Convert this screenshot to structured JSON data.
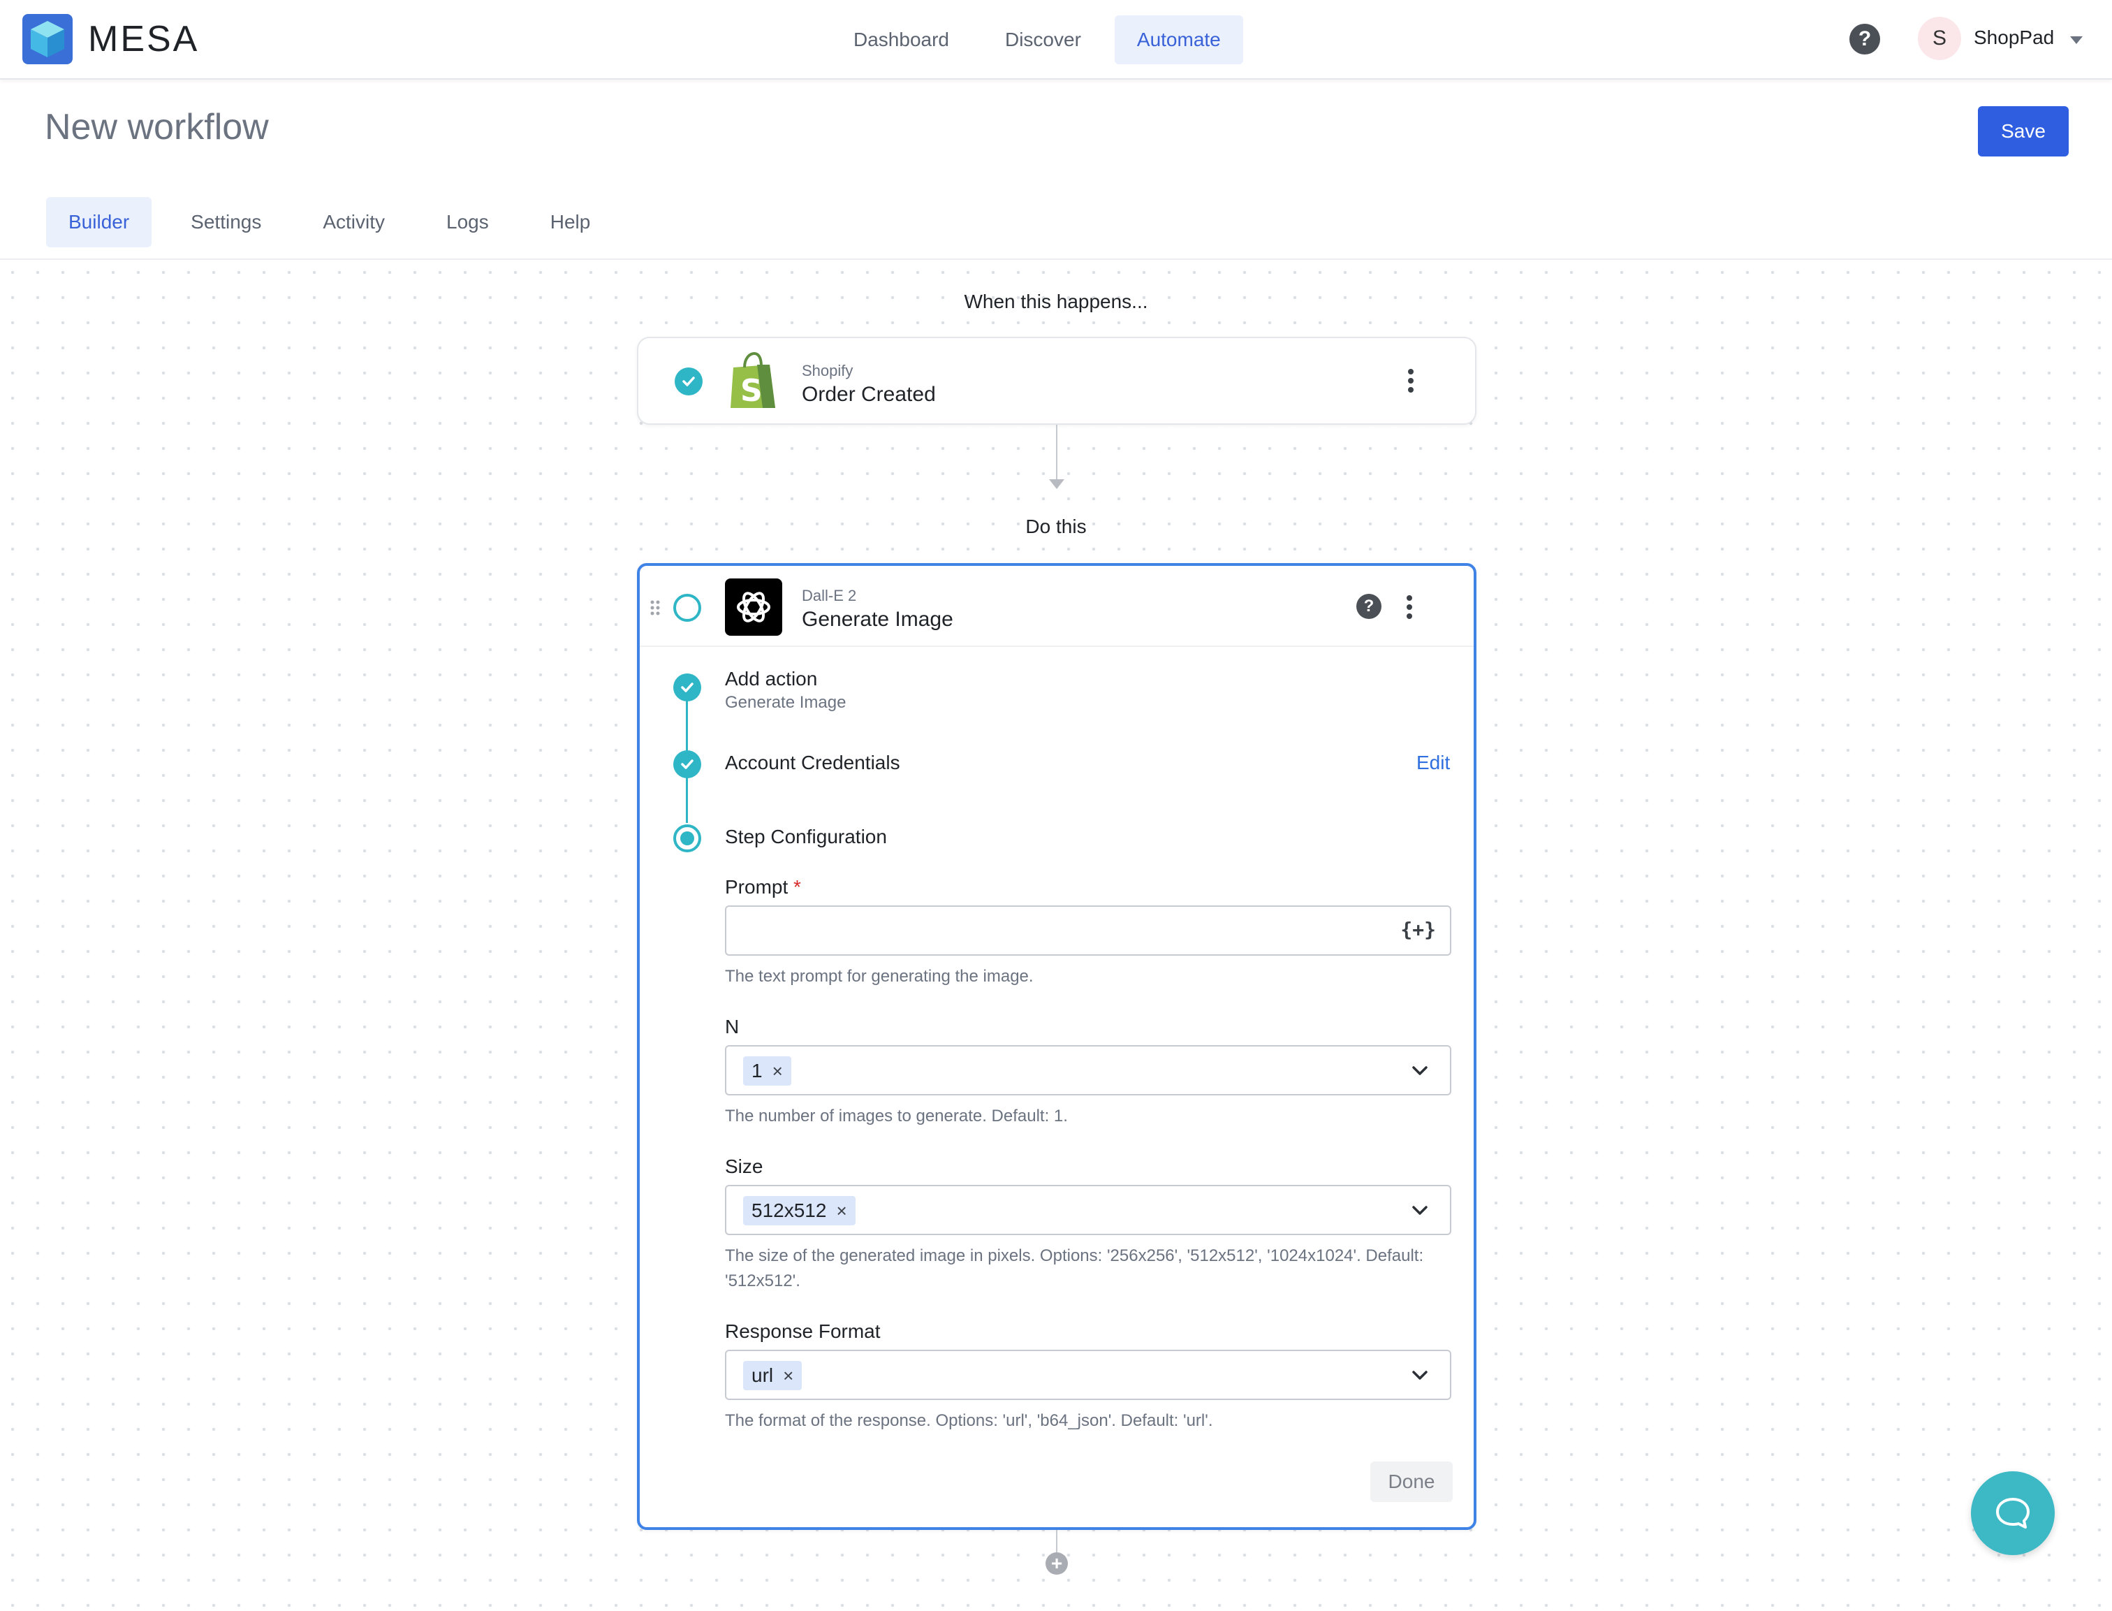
{
  "app": {
    "brand": "MESA"
  },
  "nav": {
    "items": [
      {
        "label": "Dashboard",
        "active": false
      },
      {
        "label": "Discover",
        "active": false
      },
      {
        "label": "Automate",
        "active": true
      }
    ]
  },
  "account": {
    "help_icon": "question-circle-icon",
    "avatar_letter": "S",
    "name": "ShopPad"
  },
  "header": {
    "title": "New workflow",
    "save_label": "Save"
  },
  "tabs": [
    {
      "label": "Builder",
      "active": true
    },
    {
      "label": "Settings",
      "active": false
    },
    {
      "label": "Activity",
      "active": false
    },
    {
      "label": "Logs",
      "active": false
    },
    {
      "label": "Help",
      "active": false
    }
  ],
  "trigger": {
    "section_label": "When this happens...",
    "app": "Shopify",
    "event": "Order Created",
    "status": "complete"
  },
  "action": {
    "section_label": "Do this",
    "app": "Dall-E 2",
    "event": "Generate Image",
    "steps": [
      {
        "title": "Add action",
        "subtitle": "Generate Image",
        "status": "complete"
      },
      {
        "title": "Account Credentials",
        "link": "Edit",
        "status": "complete"
      },
      {
        "title": "Step Configuration",
        "status": "active"
      }
    ],
    "fields": {
      "prompt": {
        "label": "Prompt",
        "required_mark": "*",
        "value": "",
        "variable_button": "{+}",
        "help": "The text prompt for generating the image."
      },
      "n": {
        "label": "N",
        "chip": "1",
        "help": "The number of images to generate. Default: 1."
      },
      "size": {
        "label": "Size",
        "chip": "512x512",
        "help": "The size of the generated image in pixels. Options: '256x256', '512x512', '1024x1024'. Default: '512x512'."
      },
      "response_format": {
        "label": "Response Format",
        "chip": "url",
        "help": "The format of the response. Options: 'url', 'b64_json'. Default: 'url'."
      }
    },
    "done_label": "Done"
  },
  "chip_remove": "×",
  "colors": {
    "accent": "#2f5fe0",
    "teal": "#2fb6c6",
    "selected_border": "#3f83e6",
    "nav_active_bg": "#eaf1fd"
  }
}
